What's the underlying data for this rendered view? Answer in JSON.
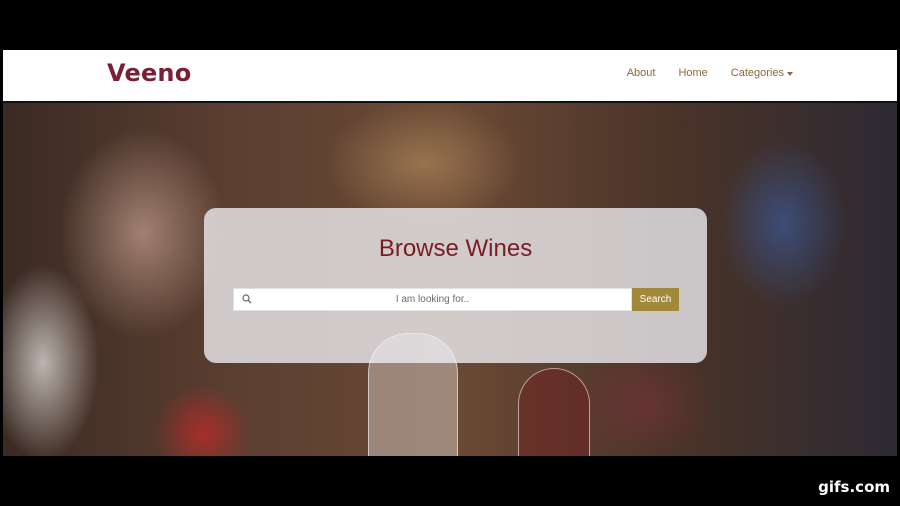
{
  "navbar": {
    "brand": "Veeno",
    "links": [
      {
        "label": "About"
      },
      {
        "label": "Home"
      },
      {
        "label": "Categories"
      }
    ]
  },
  "hero": {
    "title": "Browse Wines",
    "search": {
      "placeholder": "I am looking for..",
      "value": "",
      "button_label": "Search"
    }
  },
  "watermark": "gifs.com",
  "colors": {
    "brand": "#7a1f34",
    "title": "#7a1c24",
    "nav_link": "#8a6a3c",
    "search_button": "#a2893a"
  },
  "icons": {
    "search": "search-icon",
    "dropdown": "caret-down-icon"
  }
}
